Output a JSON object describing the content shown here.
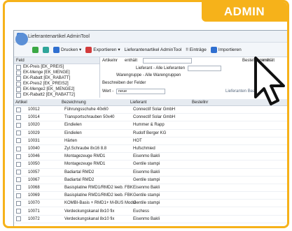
{
  "badge": {
    "label": "ADMIN"
  },
  "colors": {
    "accent": "#f6b21a"
  },
  "window": {
    "title": "Lieferantenartikel AdminTool"
  },
  "toolbar": {
    "items": [
      {
        "label": "",
        "icon": "save-icon"
      },
      {
        "label": "",
        "icon": "refresh-icon"
      },
      {
        "label": "Drucken ▾",
        "icon": "print-icon"
      },
      {
        "label": "Exportieren ▾",
        "icon": "export-icon"
      },
      {
        "label": "Lieferantenartikel AdminTool",
        "icon": ""
      },
      {
        "label": "!! Einträge",
        "icon": ""
      },
      {
        "label": "Importieren",
        "icon": "import-icon"
      }
    ]
  },
  "fields": {
    "header": "Feld",
    "items": [
      "EK-Preis [EK_PREIS]",
      "EK-Menge [EK_MENGE]",
      "EK-Rabatt [EK_RABATT]",
      "EK-Preis2 [EK_PREIS2]",
      "EK-Menge2 [EK_MENGE2]",
      "EK-Rabatt2 [EK_RABATT2]"
    ]
  },
  "filter": {
    "artikelnr_label": "Artikelnr",
    "enthaelt_label": "enthält",
    "bestellnr_label": "Bestellnummer",
    "enthaelt2_label": "enthält",
    "lieferant_dropdown": "Lieferant - Alle Lieferanten",
    "warengruppe_dropdown": "Warengruppe - Alle Warengruppen",
    "beschreiben_label": "Beschreiben der Felder",
    "wert_label": "Wert -",
    "wert_value": "neue",
    "bottom_button": "Lieferanten Bearbeiten"
  },
  "grid": {
    "columns": [
      "Artikel",
      "Bezeichnung",
      "Lieferant",
      "Bestellnr"
    ],
    "rows": [
      [
        "10012",
        "Führungsschuhe 40x60",
        "Connectif Solar GmbH",
        ""
      ],
      [
        "10014",
        "Transportschrauben 50x40",
        "Connectif Solar GmbH",
        ""
      ],
      [
        "10020",
        "Eindielen",
        "Hummer & Rapp",
        ""
      ],
      [
        "10029",
        "Eindielen",
        "Rudolf Berger KG",
        ""
      ],
      [
        "10031",
        "Härten",
        "HOT",
        ""
      ],
      [
        "10040",
        "Zyl.Schraube 8x16 8.8",
        "Hufschmied",
        ""
      ],
      [
        "10046",
        "Montagezeuge RMD1",
        "Eisenmo Bakli",
        ""
      ],
      [
        "10050",
        "Montagezeuge RMD1",
        "Gentile stampi",
        ""
      ],
      [
        "10057",
        "Badiartal RMD2",
        "Eisenmo Bakli",
        ""
      ],
      [
        "10067",
        "Badiartal RMD2",
        "Gentile stampi",
        ""
      ],
      [
        "10068",
        "Basisplatine RMD1/RMD2 leeb. FBK",
        "Eisenmo Bakli",
        ""
      ],
      [
        "10069",
        "Basisplatine RMD1/RMD2 leeb. FBK",
        "Gentile stampi",
        ""
      ],
      [
        "10070",
        "KOMBI-Basis + RMD1+ M-BUS Modul",
        "Gentile stampi",
        ""
      ],
      [
        "10071",
        "Verdeckungskanal 8x10 fix",
        "Euchess",
        ""
      ],
      [
        "10072",
        "Verdeckungskanal 8x10 fix",
        "Eisenmo Bakli",
        ""
      ]
    ]
  }
}
